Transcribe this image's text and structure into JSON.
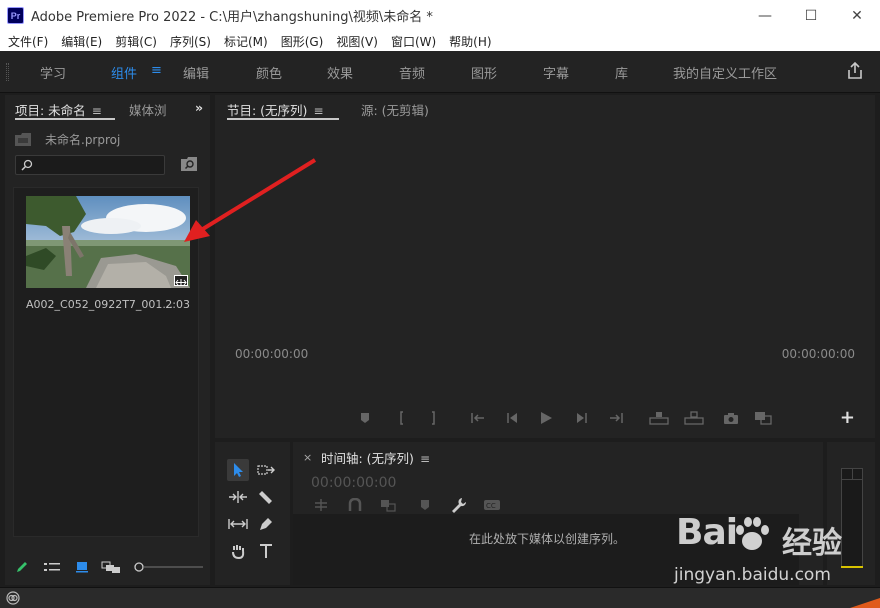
{
  "window": {
    "logo_text": "Pr",
    "title": "Adobe Premiere Pro 2022 - C:\\用户\\zhangshuning\\视频\\未命名 *",
    "minimize": "—",
    "maximize": "☐",
    "close": "✕"
  },
  "menu": [
    "文件(F)",
    "编辑(E)",
    "剪辑(C)",
    "序列(S)",
    "标记(M)",
    "图形(G)",
    "视图(V)",
    "窗口(W)",
    "帮助(H)"
  ],
  "workspaces": {
    "tabs": [
      "学习",
      "组件",
      "编辑",
      "颜色",
      "效果",
      "音频",
      "图形",
      "字幕",
      "库",
      "我的自定义工作区"
    ],
    "active": "组件",
    "menu_icon": "≡"
  },
  "project_panel": {
    "tab_active": "项目: 未命名",
    "tab_menu": "≡",
    "tab_inactive": "媒体浏",
    "overflow": "»",
    "file_name": "未命名.prproj",
    "search_placeholder": "",
    "clip": {
      "name": "A002_C052_0922T7_001...",
      "duration": "2:03"
    }
  },
  "monitor": {
    "tab_program": "节目: (无序列)",
    "tab_program_menu": "≡",
    "tab_source": "源: (无剪辑)",
    "timecode_left": "00:00:00:00",
    "timecode_right": "00:00:00:00",
    "add_button": "+"
  },
  "timeline": {
    "close": "×",
    "title": "时间轴: (无序列)",
    "menu": "≡",
    "timecode": "00:00:00:00",
    "drop_hint": "在此处放下媒体以创建序列。"
  },
  "watermark": {
    "logo": "Bai",
    "logo_end": "经验",
    "url": "jingyan.baidu.com"
  },
  "colors": {
    "accent": "#2d8ceb",
    "arrow": "#e02020",
    "meter_level": "#d8c300"
  }
}
